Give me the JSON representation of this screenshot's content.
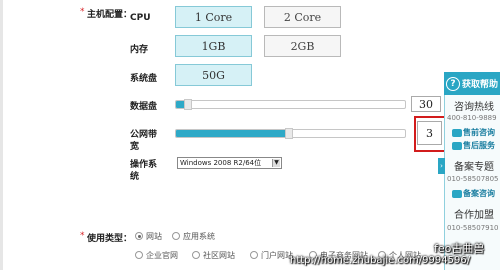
{
  "section": {
    "required_mark": "*",
    "title": "主机配置："
  },
  "cpu": {
    "label": "CPU",
    "options": [
      "1 Core",
      "2 Core"
    ],
    "selected": "1 Core"
  },
  "memory": {
    "label": "内存",
    "options": [
      "1GB",
      "2GB"
    ],
    "selected": "1GB"
  },
  "system_disk": {
    "label": "系统盘",
    "value": "50G"
  },
  "data_disk": {
    "label": "数据盘",
    "value": "30",
    "fill_fraction": 0.04
  },
  "bandwidth": {
    "label_line1": "公网带",
    "label_line2": "宽",
    "value": "3",
    "fill_fraction": 0.48
  },
  "os": {
    "label_line1": "操作系",
    "label_line2": "统",
    "selected": "Windows 2008 R2/64位"
  },
  "usage": {
    "required_mark": "*",
    "label": "使用类型：",
    "primary": [
      "网站",
      "应用系统"
    ],
    "primary_selected": "网站",
    "secondary": [
      "企业官网",
      "社区网站",
      "门户网站",
      "电子商务网站",
      "个人网站"
    ]
  },
  "help_panel": {
    "header": "获取帮助",
    "hotline_title": "咨询热线",
    "hotline_number": "400-810-9889",
    "presale_link": "售前咨询",
    "aftersale_link": "售后服务",
    "filing_title": "备案专题",
    "filing_number": "010-58507805",
    "filing_link": "备案咨询",
    "cooperation_title": "合作加盟",
    "cooperation_number": "010-58507910"
  },
  "watermark": {
    "line1": "feo古曲兽",
    "line2": "http://home.zhubajie.com/9994596/"
  },
  "colors": {
    "accent": "#2aa6c4",
    "selected_bg": "#d6f1f6",
    "required": "#d8262a",
    "highlight": "#d21c1c"
  }
}
